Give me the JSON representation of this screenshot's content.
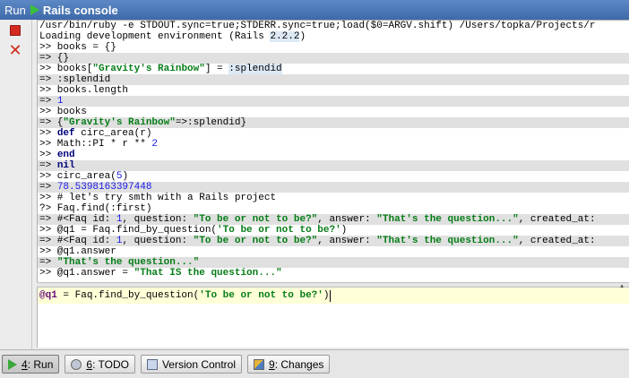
{
  "titlebar": {
    "run_label": "Run",
    "title": "Rails console"
  },
  "toolbar": {
    "stop_icon": "stop-icon",
    "close_icon": "close-icon"
  },
  "console": {
    "lines": [
      {
        "type": "out",
        "segments": [
          {
            "t": "/usr/bin/ruby -e STDOUT.sync=true;STDERR.sync=true;load($0=ARGV.shift) /Users/topka/Projects/r",
            "s": ""
          }
        ]
      },
      {
        "type": "out",
        "segments": [
          {
            "t": "Loading development environment (Rails ",
            "s": ""
          },
          {
            "t": "2.2.2",
            "s": "hl"
          },
          {
            "t": ")",
            "s": ""
          }
        ]
      },
      {
        "type": "in",
        "segments": [
          {
            "t": ">> books = {}",
            "s": ""
          }
        ]
      },
      {
        "type": "result",
        "segments": [
          {
            "t": "=> {}",
            "s": ""
          }
        ]
      },
      {
        "type": "in",
        "segments": [
          {
            "t": ">> books[",
            "s": ""
          },
          {
            "t": "\"Gravity's Rainbow\"",
            "s": "str"
          },
          {
            "t": "] = ",
            "s": ""
          },
          {
            "t": ":splendid",
            "s": "sym"
          }
        ]
      },
      {
        "type": "result",
        "segments": [
          {
            "t": "=> :splendid",
            "s": ""
          }
        ]
      },
      {
        "type": "in",
        "segments": [
          {
            "t": ">> books.length",
            "s": ""
          }
        ]
      },
      {
        "type": "result",
        "segments": [
          {
            "t": "=> ",
            "s": ""
          },
          {
            "t": "1",
            "s": "num"
          }
        ]
      },
      {
        "type": "in",
        "segments": [
          {
            "t": ">> books",
            "s": ""
          }
        ]
      },
      {
        "type": "result",
        "segments": [
          {
            "t": "=> {",
            "s": ""
          },
          {
            "t": "\"Gravity's Rainbow\"",
            "s": "str"
          },
          {
            "t": "=>:splendid}",
            "s": ""
          }
        ]
      },
      {
        "type": "in",
        "segments": [
          {
            "t": ">> ",
            "s": ""
          },
          {
            "t": "def",
            "s": "kw"
          },
          {
            "t": " circ_area(r)",
            "s": ""
          }
        ]
      },
      {
        "type": "in",
        "segments": [
          {
            "t": ">> Math::PI * r ** ",
            "s": ""
          },
          {
            "t": "2",
            "s": "num"
          }
        ]
      },
      {
        "type": "in",
        "segments": [
          {
            "t": ">> ",
            "s": ""
          },
          {
            "t": "end",
            "s": "kw"
          }
        ]
      },
      {
        "type": "result",
        "segments": [
          {
            "t": "=> ",
            "s": ""
          },
          {
            "t": "nil",
            "s": "kw"
          }
        ]
      },
      {
        "type": "in",
        "segments": [
          {
            "t": ">> circ_area(",
            "s": ""
          },
          {
            "t": "5",
            "s": "num"
          },
          {
            "t": ")",
            "s": ""
          }
        ]
      },
      {
        "type": "result",
        "segments": [
          {
            "t": "=> ",
            "s": ""
          },
          {
            "t": "78.5398163397448",
            "s": "num"
          }
        ]
      },
      {
        "type": "in",
        "segments": [
          {
            "t": ">> # let's try smth with a Rails project",
            "s": ""
          }
        ]
      },
      {
        "type": "in",
        "segments": [
          {
            "t": "?> Faq.find(:first)",
            "s": ""
          }
        ]
      },
      {
        "type": "result",
        "segments": [
          {
            "t": "=> #<Faq id: ",
            "s": ""
          },
          {
            "t": "1",
            "s": "num"
          },
          {
            "t": ", question: ",
            "s": ""
          },
          {
            "t": "\"To be or not to be?\"",
            "s": "str"
          },
          {
            "t": ", answer: ",
            "s": ""
          },
          {
            "t": "\"That's the question...\"",
            "s": "str"
          },
          {
            "t": ", created_at:",
            "s": ""
          }
        ]
      },
      {
        "type": "in",
        "segments": [
          {
            "t": ">> @q1 = Faq.find_by_question(",
            "s": ""
          },
          {
            "t": "'To be or not to be?'",
            "s": "str"
          },
          {
            "t": ")",
            "s": ""
          }
        ]
      },
      {
        "type": "result",
        "segments": [
          {
            "t": "=> #<Faq id: ",
            "s": ""
          },
          {
            "t": "1",
            "s": "num"
          },
          {
            "t": ", question: ",
            "s": ""
          },
          {
            "t": "\"To be or not to be?\"",
            "s": "str"
          },
          {
            "t": ", answer: ",
            "s": ""
          },
          {
            "t": "\"That's the question...\"",
            "s": "str"
          },
          {
            "t": ", created_at:",
            "s": ""
          }
        ]
      },
      {
        "type": "in",
        "segments": [
          {
            "t": ">> @q1.answer",
            "s": ""
          }
        ]
      },
      {
        "type": "result",
        "segments": [
          {
            "t": "=> ",
            "s": ""
          },
          {
            "t": "\"That's the question...\"",
            "s": "str"
          }
        ]
      },
      {
        "type": "in",
        "segments": [
          {
            "t": ">> @q1.answer = ",
            "s": ""
          },
          {
            "t": "\"That IS the question...\"",
            "s": "str"
          }
        ]
      }
    ]
  },
  "input": {
    "var": "@q1",
    "mid": " = Faq.find_by_question(",
    "str": "'To be or not to be?'",
    "end": ")"
  },
  "bottom_tabs": [
    {
      "num": "4",
      "label": ": Run",
      "icon": "run-icon"
    },
    {
      "num": "6",
      "label": ": TODO",
      "icon": "todo-icon"
    },
    {
      "num": "",
      "label": "Version Control",
      "icon": "version-control-icon"
    },
    {
      "num": "9",
      "label": ": Changes",
      "icon": "changes-icon"
    }
  ]
}
